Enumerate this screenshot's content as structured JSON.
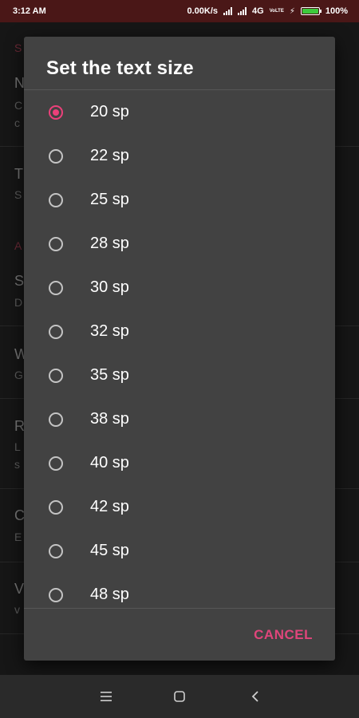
{
  "status_bar": {
    "time": "3:12 AM",
    "speed": "0.00K/s",
    "network": "4G",
    "volte": "VoLTE",
    "battery": "100%"
  },
  "background_screen": {
    "items": [
      {
        "header": "S"
      },
      {
        "title": "N",
        "sub": [
          "C",
          "c"
        ]
      },
      {
        "title": "T",
        "sub": [
          "S"
        ]
      },
      {
        "header": "A"
      },
      {
        "title": "S",
        "sub": [
          "D"
        ]
      },
      {
        "title": "W",
        "sub": [
          "G"
        ]
      },
      {
        "title": "R",
        "sub": [
          "L",
          "s"
        ]
      },
      {
        "title": "C",
        "sub": [
          "E"
        ]
      },
      {
        "title": "V",
        "sub": [
          "v"
        ]
      }
    ]
  },
  "dialog": {
    "title": "Set the text size",
    "selected_index": 0,
    "options": [
      "20 sp",
      "22 sp",
      "25 sp",
      "28 sp",
      "30 sp",
      "32 sp",
      "35 sp",
      "38 sp",
      "40 sp",
      "42 sp",
      "45 sp",
      "48 sp"
    ],
    "cancel_label": "CANCEL",
    "accent_color": "#ec407a"
  },
  "nav_bar": {
    "icons": [
      "menu-icon",
      "home-icon",
      "back-icon"
    ]
  }
}
